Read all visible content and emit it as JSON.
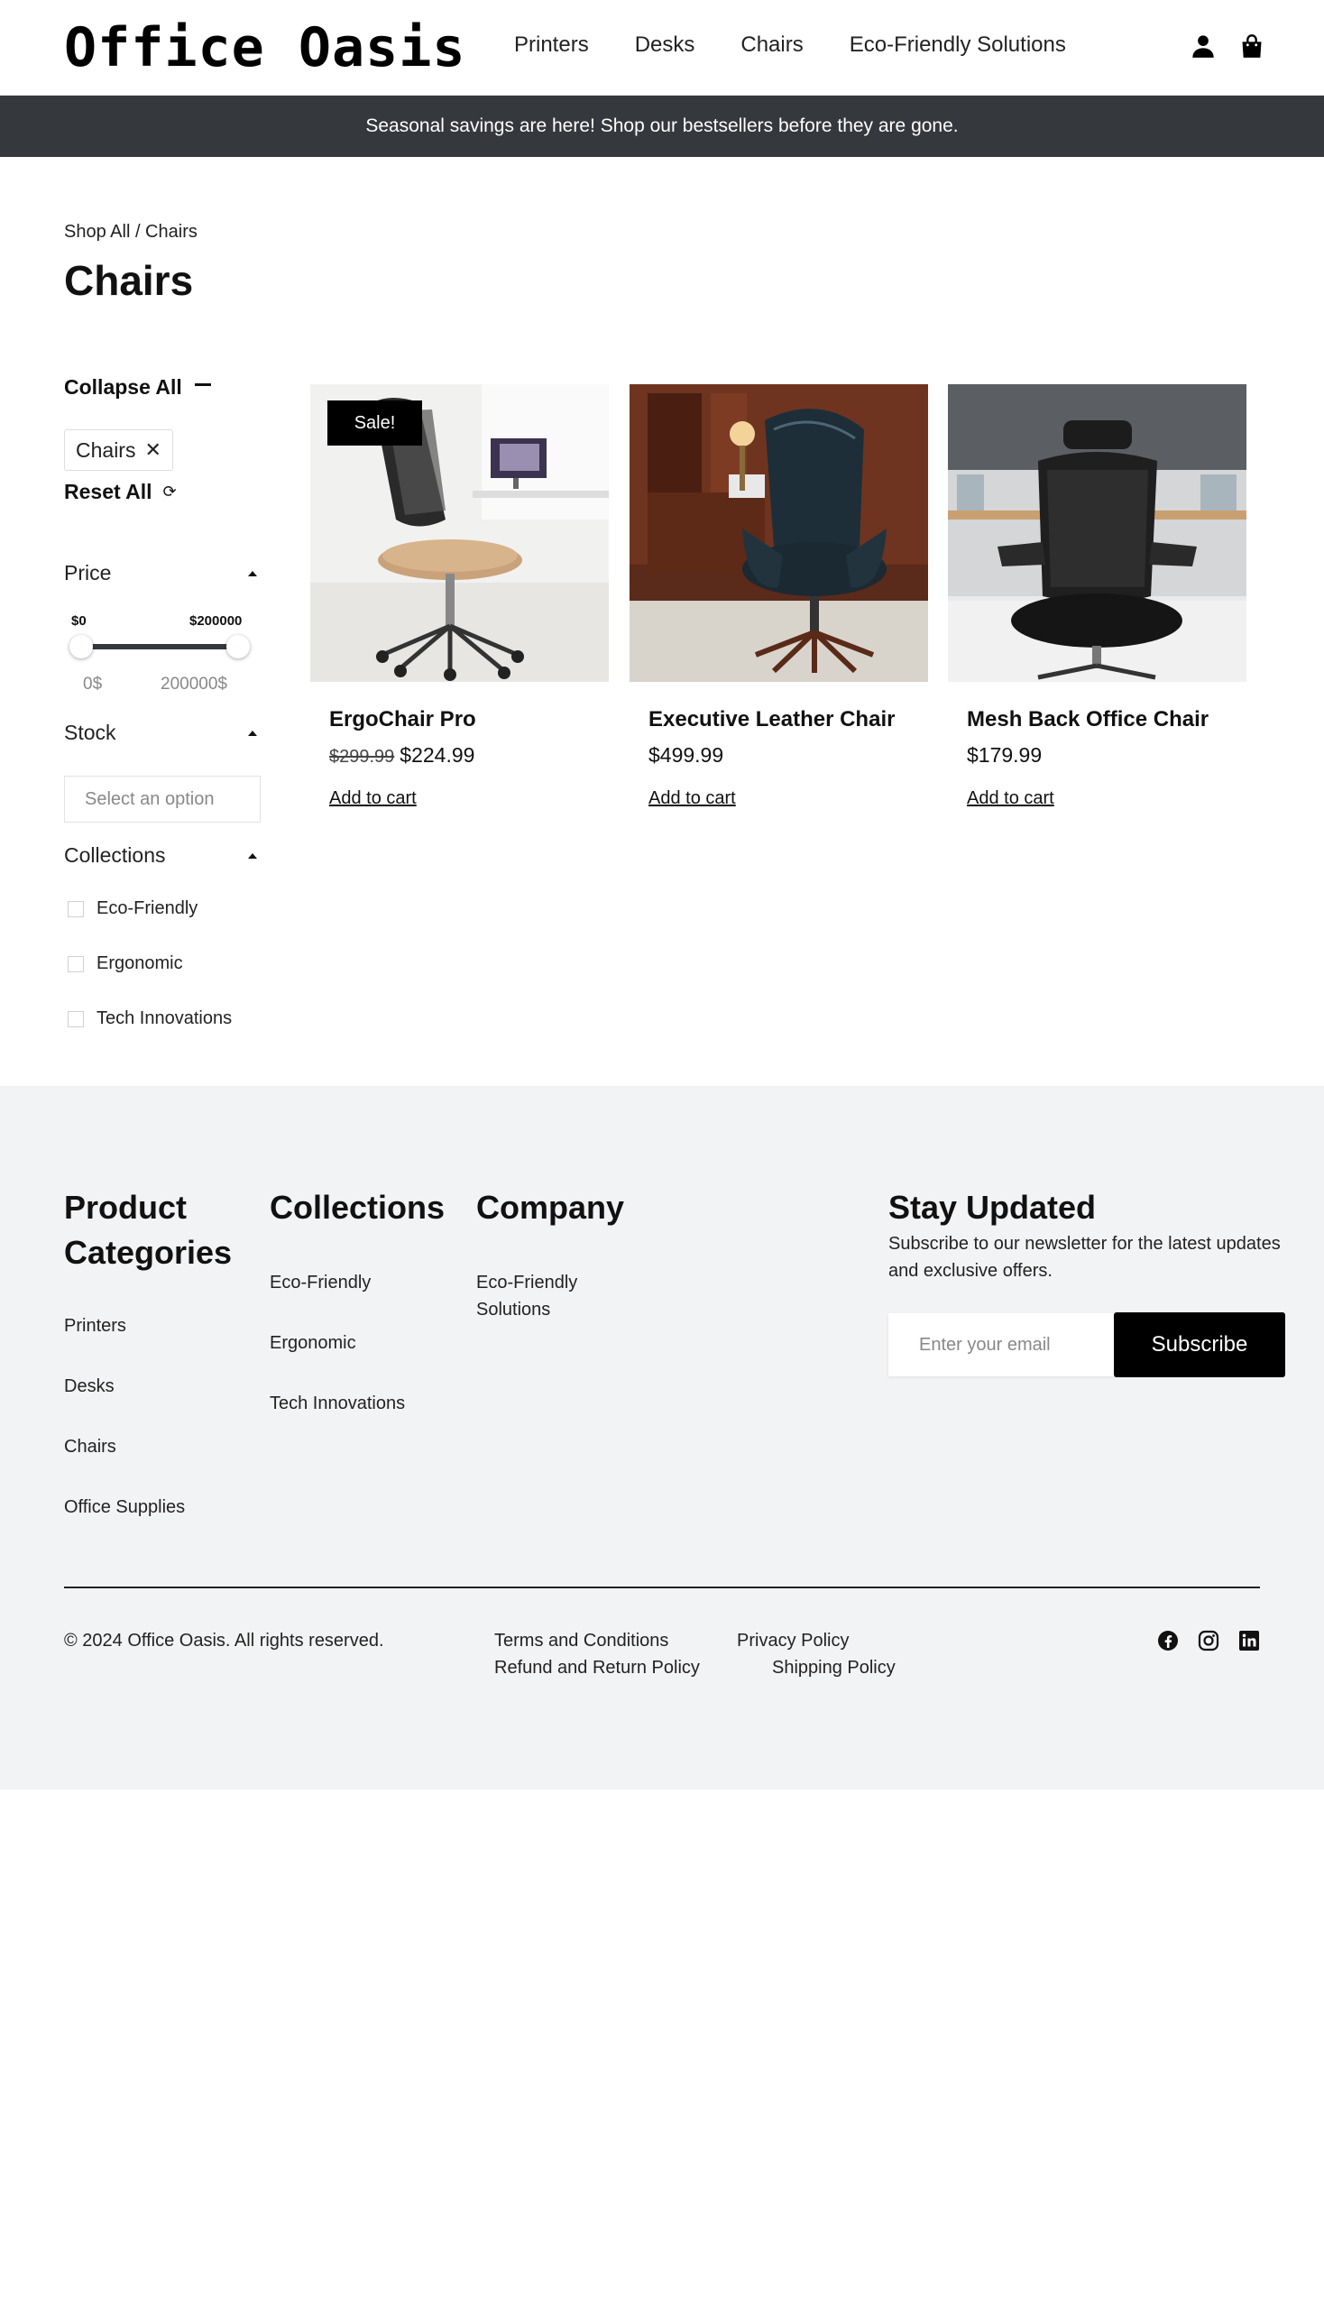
{
  "header": {
    "logo": "Office Oasis",
    "nav": [
      "Printers",
      "Desks",
      "Chairs",
      "Eco-Friendly Solutions"
    ],
    "icons": [
      "account-icon",
      "shopping-bag-icon"
    ]
  },
  "banner": {
    "text": "Seasonal savings are here! Shop our bestsellers before they are gone."
  },
  "breadcrumb": "Shop All / Chairs",
  "page_title": "Chairs",
  "filters": {
    "collapse_all": "Collapse All",
    "active_chip": "Chairs",
    "chip_remove": "✕",
    "reset_all": "Reset All",
    "price": {
      "label": "Price",
      "min_label": "$0",
      "max_label": "$200000",
      "min_value": "0$",
      "max_value": "200000$",
      "range_min": 0,
      "range_max": 200000
    },
    "stock": {
      "label": "Stock",
      "placeholder": "Select an option"
    },
    "collections": {
      "label": "Collections",
      "options": [
        "Eco-Friendly",
        "Ergonomic",
        "Tech Innovations"
      ]
    }
  },
  "products": [
    {
      "name": "ErgoChair Pro",
      "old_price": "$299.99",
      "price": "$224.99",
      "badge": "Sale!",
      "cta": "Add to cart"
    },
    {
      "name": "Executive Leather Chair",
      "old_price": "",
      "price": "$499.99",
      "badge": "",
      "cta": "Add to cart"
    },
    {
      "name": "Mesh Back Office Chair",
      "old_price": "",
      "price": "$179.99",
      "badge": "",
      "cta": "Add to cart"
    }
  ],
  "footer": {
    "product_categories": {
      "title_line1": "Product",
      "title_line2": "Categories",
      "links": [
        "Printers",
        "Desks",
        "Chairs",
        "Office Supplies"
      ]
    },
    "collections": {
      "title": "Collections",
      "links": [
        "Eco-Friendly",
        "Ergonomic",
        "Tech Innovations"
      ]
    },
    "company": {
      "title": "Company",
      "link_line1": "Eco-Friendly",
      "link_line2": "Solutions"
    },
    "newsletter": {
      "title": "Stay Updated",
      "text": "Subscribe to our newsletter for the latest updates and exclusive offers.",
      "placeholder": "Enter your email",
      "button": "Subscribe"
    },
    "copyright": "© 2024 Office Oasis. All rights reserved.",
    "legal": [
      "Terms and Conditions",
      "Privacy Policy",
      "Refund and Return Policy",
      "Shipping Policy"
    ],
    "social": [
      "facebook-icon",
      "instagram-icon",
      "linkedin-icon"
    ]
  },
  "colors": {
    "banner_bg": "#35383d",
    "footer_bg": "#f2f3f5",
    "badge_bg": "#000000"
  }
}
